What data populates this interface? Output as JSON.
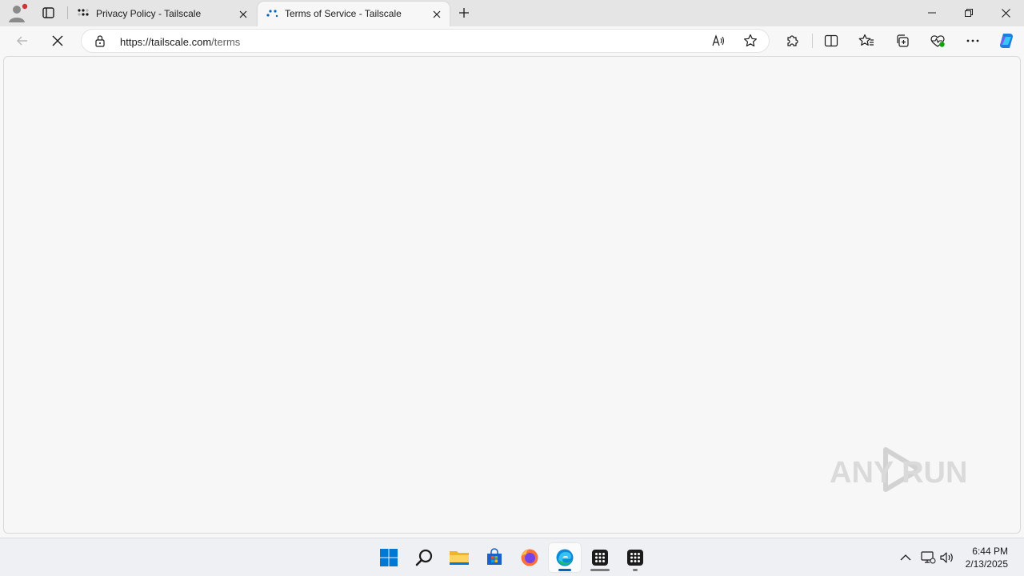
{
  "browser": {
    "tabs": [
      {
        "title": "Privacy Policy - Tailscale",
        "active": false
      },
      {
        "title": "Terms of Service - Tailscale",
        "active": true
      }
    ],
    "address": {
      "host": "https://tailscale.com",
      "path": "/terms"
    }
  },
  "watermark": {
    "text": "ANY RUN"
  },
  "taskbar": {
    "apps": [
      "start-icon",
      "search-icon",
      "file-explorer-icon",
      "store-icon",
      "firefox-icon",
      "edge-icon",
      "app-grid-icon",
      "app-grid-icon"
    ],
    "clock": {
      "time": "6:44 PM",
      "date": "2/13/2025"
    }
  },
  "colors": {
    "accent": "#0067c0",
    "tab_strip": "#e5e5e5",
    "page_bg": "#f7f7f7"
  }
}
